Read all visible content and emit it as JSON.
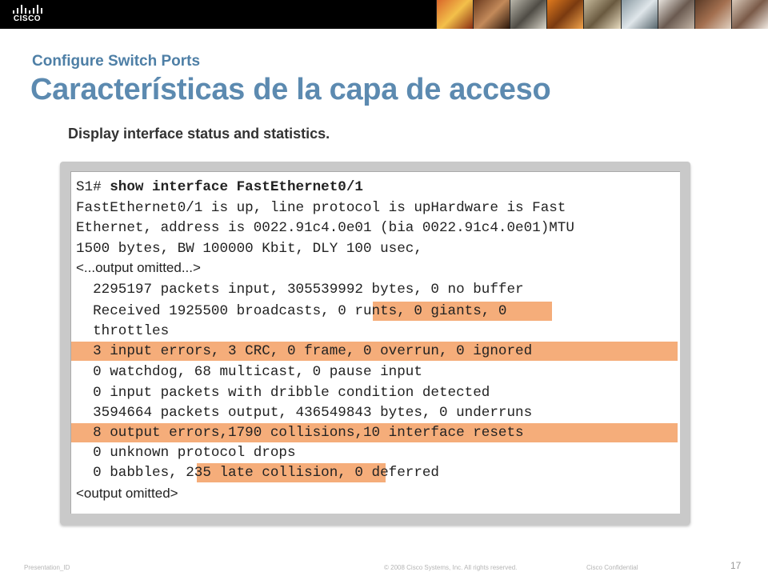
{
  "header": {
    "logo_text": "CISCO",
    "subtitle": "Configure Switch Ports",
    "title": "Características de la capa de acceso"
  },
  "caption": "Display interface status and statistics.",
  "terminal": {
    "prompt": "S1# ",
    "command": "show interface FastEthernet0/1",
    "lines": [
      "FastEthernet0/1 is up, line protocol is upHardware is Fast",
      "Ethernet, address is 0022.91c4.0e01 (bia 0022.91c4.0e01)MTU",
      "1500 bytes, BW 100000 Kbit, DLY 100 usec,",
      "<...output omitted...>",
      "  2295197 packets input, 305539992 bytes, 0 no buffer",
      "  Received 1925500 broadcasts, 0 runts, 0 giants, 0",
      "  throttles",
      "  3 input errors, 3 CRC, 0 frame, 0 overrun, 0 ignored",
      "  0 watchdog, 68 multicast, 0 pause input",
      "  0 input packets with dribble condition detected",
      "  3594664 packets output, 436549843 bytes, 0 underruns",
      "  8 output errors,1790 collisions,10 interface resets",
      "  0 unknown protocol drops",
      "  0 babbles, 235 late collision, 0 deferred",
      "<output omitted>"
    ]
  },
  "footer": {
    "presentation_id": "Presentation_ID",
    "copyright": "© 2008 Cisco Systems, Inc. All rights reserved.",
    "confidential": "Cisco Confidential",
    "page_number": "17"
  },
  "colors": {
    "banner": "#000000",
    "title": "#5c8ab0",
    "highlight": "#f5ad7a"
  }
}
